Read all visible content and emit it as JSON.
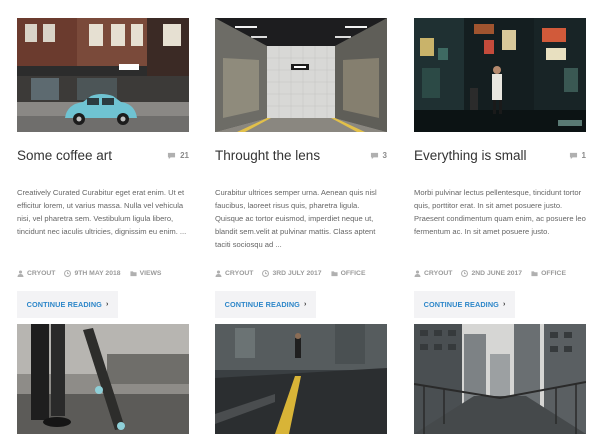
{
  "posts": [
    {
      "title": "Some coffee art",
      "comment_count": "21",
      "excerpt": "Creatively Curated Curabitur eget erat enim. Ut et efficitur lorem, ut varius massa. Nulla vel vehicula nisi, vel pharetra sem. Vestibulum ligula libero, tincidunt nec iaculis ultricies, dignissim eu enim. ...",
      "author": "CRYOUT",
      "date": "9TH MAY 2018",
      "category": "VIEWS",
      "button_label": "CONTINUE READING",
      "image_alt": "Blue vintage car on a city street"
    },
    {
      "title": "Throught the lens",
      "comment_count": "3",
      "excerpt": "Curabitur ultrices semper urna. Aenean quis nisl faucibus, laoreet risus quis, pharetra ligula. Quisque ac tortor euismod, imperdiet neque ut, blandit sem.velit at pulvinar mattis. Class aptent taciti sociosqu ad ...",
      "author": "CRYOUT",
      "date": "3RD JULY 2017",
      "category": "OFFICE",
      "button_label": "CONTINUE READING",
      "image_alt": "Subway station corridor"
    },
    {
      "title": "Everything is small",
      "comment_count": "1",
      "excerpt": "Morbi pulvinar lectus pellentesque, tincidunt tortor quis, porttitor erat. In sit amet posuere justo. Praesent condimentum quam enim, ac posuere leo fermentum ac. In sit amet posuere justo.",
      "author": "CRYOUT",
      "date": "2ND JUNE 2017",
      "category": "OFFICE",
      "button_label": "CONTINUE READING",
      "image_alt": "Night street market with signs"
    }
  ],
  "row2_images": [
    {
      "alt": "Skateboard leaning against legs"
    },
    {
      "alt": "Road with yellow lane markings"
    },
    {
      "alt": "City bridge among skyscrapers"
    }
  ],
  "icons": {
    "comment": "comment-icon",
    "author": "user-icon",
    "date": "clock-icon",
    "category": "folder-icon",
    "chevron": "chevron-right-icon"
  },
  "colors": {
    "link": "#2e87c9",
    "title": "#333333",
    "text": "#666666",
    "meta": "#9a9a9a",
    "button_bg": "#f3f3f5"
  }
}
